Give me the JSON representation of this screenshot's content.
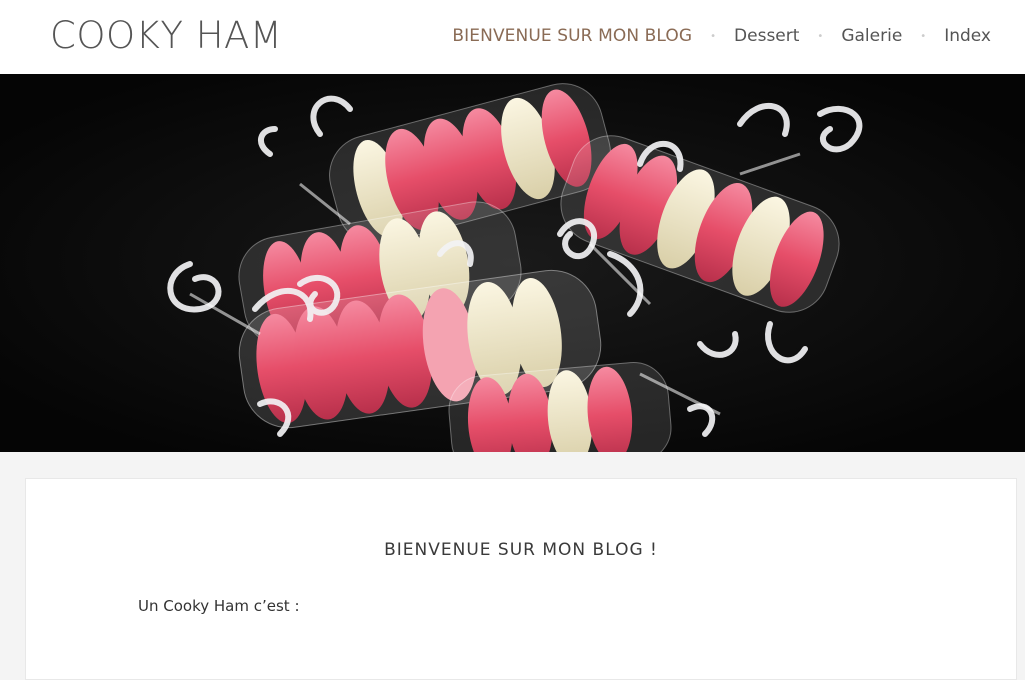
{
  "site": {
    "title": "COOKY HAM"
  },
  "nav": {
    "items": [
      {
        "label": "BIENVENUE SUR MON BLOG",
        "active": true
      },
      {
        "label": "Dessert",
        "active": false
      },
      {
        "label": "Galerie",
        "active": false
      },
      {
        "label": "Index",
        "active": false
      }
    ],
    "separator": "•"
  },
  "hero": {
    "subject": "macarons wrapped in cellophane with white ribbons",
    "colors": {
      "background": "#060606",
      "pink": "#e9536c",
      "light_pink": "#f07c8e",
      "cream": "#efe7c8",
      "ribbon": "#f2f2f4"
    }
  },
  "post": {
    "title": "BIENVENUE SUR MON BLOG !",
    "intro": "Un Cooky Ham c’est  :"
  },
  "colors": {
    "accent": "#8a6b55",
    "text": "#555555",
    "page_bg": "#f4f4f4"
  }
}
